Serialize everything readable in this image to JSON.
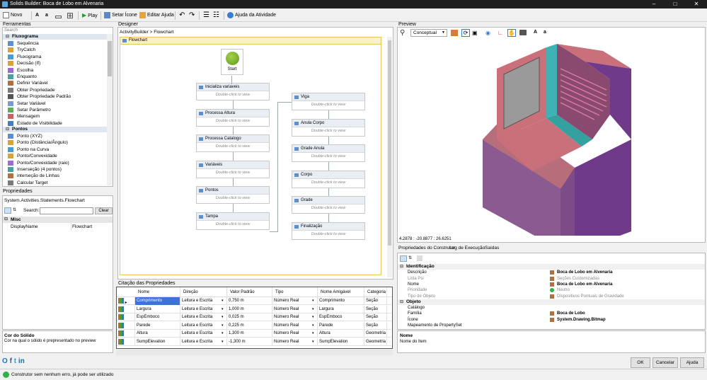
{
  "window": {
    "title": "Solids Builder: Boca de Lobo em Alvenaria"
  },
  "toolbar": {
    "novo": "Novo",
    "font_bold": "A",
    "font_small": "a",
    "play": "Play",
    "setar_icone": "Setar Ícone",
    "editar_ajuda": "Editar Ajuda",
    "ajuda_atividade": "Ajuda da Atividade"
  },
  "ferramentas": {
    "title": "Ferramentas",
    "search_placeholder": "Search",
    "cat1": "Fluxograma",
    "items1": [
      "Sequência",
      "TryCatch",
      "Fluxograma",
      "Decisão (If)",
      "Escolha",
      "Enquanto",
      "Definir Variável",
      "Obter Propriedade",
      "Obter Propriedade Padrão",
      "Setar Variável",
      "Setar Parâmetro",
      "Mensagem",
      "Estado de Visibilidade"
    ],
    "cat2": "Pontos",
    "items2": [
      "Ponto (XYZ)",
      "Ponto (Distância/Ângulo)",
      "Ponto na Curva",
      "Ponto/Convexidade",
      "Ponto/Convexidade (raio)",
      "Inserseção (4 pontos)",
      "interseção de Linhas",
      "Calcular Target"
    ]
  },
  "propriedades": {
    "title": "Propriedades",
    "type": "System.Activities.Statements.Flowchart",
    "search_label": "Search:",
    "clear": "Clear",
    "category": "Misc",
    "prop_name": "DisplayName",
    "prop_value": "Flowchart"
  },
  "cor_solido": {
    "title": "Cor do Sólido",
    "desc": "Cor na qual o sólido é prepresentado no preview"
  },
  "designer": {
    "title": "Designer",
    "breadcrumb1": "ActivityBuilder",
    "breadcrumb_sep": ">",
    "breadcrumb2": "Flowchart",
    "flowchart_label": "Flowchart",
    "start": "Start",
    "hint": "Double-click to view",
    "col1": [
      "Inicializa variaveis",
      "Processa Altura",
      "Processa Catalogo",
      "Variáveis",
      "Pontos",
      "Tampa"
    ],
    "col2": [
      "Viga",
      "Anula Corpo",
      "Grade Anula",
      "Corpo",
      "Grade",
      "Finalização"
    ]
  },
  "citacao": {
    "title": "Citação das Propriedades",
    "headers": [
      "Nome",
      "Direção",
      "Valor Padrão",
      "Tipo",
      "Nome Amigável",
      "Categoria"
    ],
    "rows": [
      [
        "Comprimento",
        "Leitura e Escrita",
        "0,750 m",
        "Número Real",
        "Comprimento",
        "Seção"
      ],
      [
        "Largura",
        "Leitura e Escrita",
        "1,000 m",
        "Número Real",
        "Largura",
        "Seção"
      ],
      [
        "EspEmboco",
        "Leitura e Escrita",
        "0,025 m",
        "Número Real",
        "EspEmboco",
        "Seção"
      ],
      [
        "Parede",
        "Leitura e Escrita",
        "0,225 m",
        "Número Real",
        "Parede",
        "Seção"
      ],
      [
        "Altura",
        "Leitura e Escrita",
        "1,300 m",
        "Número Real",
        "Altura",
        "Geometria"
      ],
      [
        "SumpElevation",
        "Leitura e Escrita",
        "-1,300 m",
        "Número Real",
        "SumpElevation",
        "Geometria"
      ]
    ]
  },
  "preview": {
    "title": "Preview",
    "mode": "Conceptual",
    "coords": "4.2878 : -20.8877 : 26.6251",
    "font_bold": "A",
    "font_small": "a"
  },
  "construtor": {
    "tabs": [
      "Propriedades do Construtor",
      "Log de Execução",
      "Saídas"
    ],
    "sec1": "Identificação",
    "rows1": [
      [
        "Descrição",
        "Boca de Lobo em Alvenaria"
      ],
      [
        "Lista Psi",
        "Seções Customizadas"
      ],
      [
        "Nome",
        "Boca de Lobo em Alvenaria"
      ],
      [
        "Prioridade",
        "Neutro"
      ],
      [
        "Tipo de Objeto",
        "Dispositivos Pontuais de Gravidade"
      ]
    ],
    "sec2": "Objeto",
    "rows2": [
      [
        "Catálogo",
        ""
      ],
      [
        "Família",
        "Boca de Lobo"
      ],
      [
        "Ícone",
        "System.Drawing.Bitmap"
      ],
      [
        "Mapeamento de PropertySet",
        ""
      ]
    ],
    "help_title": "Nome",
    "help_desc": "Nome do Item"
  },
  "buttons": {
    "ok": "OK",
    "cancelar": "Cancelar",
    "ajuda": "Ajuda"
  },
  "status": {
    "text": "Construtor sem nenhum erro, já pode ser utilizado"
  },
  "colors": {
    "accent": "#1e73be",
    "titlebar": "#1f1f1f",
    "solid_pink": "#c9707a",
    "solid_purple": "#7a3b86",
    "solid_teal": "#3fb3b3"
  }
}
